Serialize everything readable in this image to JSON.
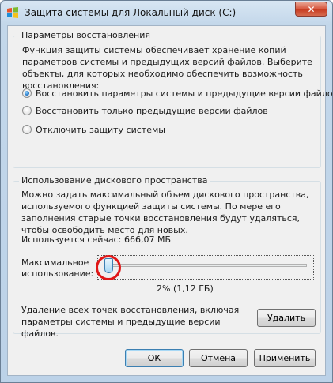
{
  "window": {
    "title": "Защита системы для Локальный диск (C:)",
    "close_label": "✕"
  },
  "restore": {
    "legend": "Параметры восстановления",
    "description": "Функция защиты системы обеспечивает хранение копий параметров системы и предыдущих версий файлов. Выберите объекты, для которых необходимо обеспечить возможность восстановления:",
    "options": [
      {
        "label": "Восстановить параметры системы и предыдущие версии файлов",
        "checked": true
      },
      {
        "label": "Восстановить только предыдущие версии файлов",
        "checked": false
      },
      {
        "label": "Отключить защиту системы",
        "checked": false
      }
    ]
  },
  "disk": {
    "legend": "Использование дискового пространства",
    "description": "Можно задать максимальный объем дискового пространства, используемого функцией защиты системы. По мере его заполнения старые точки восстановления будут удаляться, чтобы освободить место для новых.",
    "used_label": "Используется сейчас:",
    "used_value": "666,07 МБ",
    "max_label_line1": "Максимальное",
    "max_label_line2": "использование:",
    "slider_percent": 2,
    "slider_readout": "2% (1,12 ГБ)",
    "delete_text": "Удаление всех точек восстановления, включая параметры системы и предыдущие версии файлов.",
    "delete_button": "Удалить"
  },
  "footer": {
    "ok": "ОК",
    "cancel": "Отмена",
    "apply": "Применить"
  },
  "colors": {
    "highlight_ring": "#e01616",
    "accent": "#3c7fb1"
  }
}
